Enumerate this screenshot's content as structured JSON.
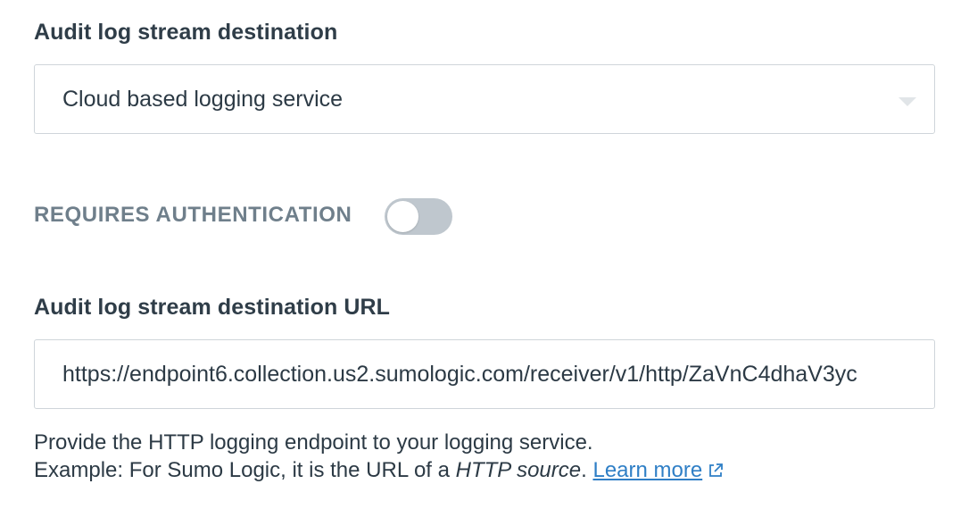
{
  "destination": {
    "label": "Audit log stream destination",
    "selected_value": "Cloud based logging service"
  },
  "authentication": {
    "label": "REQUIRES AUTHENTICATION",
    "enabled": false
  },
  "url": {
    "label": "Audit log stream destination URL",
    "value": "https://endpoint6.collection.us2.sumologic.com/receiver/v1/http/ZaVnC4dhaV3yc"
  },
  "help": {
    "line1": "Provide the HTTP logging endpoint to your logging service.",
    "line2_prefix": "Example: For Sumo Logic, it is the URL of a ",
    "line2_emphasis": "HTTP source",
    "line2_suffix": ". ",
    "learn_more": "Learn more",
    "learn_more_icon": "external-link-icon"
  },
  "colors": {
    "link": "#2f7fc6",
    "toggle_off": "#bfc7ce",
    "text": "#2c3a45",
    "muted_label": "#6f7f8b",
    "border": "#cfd5da"
  }
}
